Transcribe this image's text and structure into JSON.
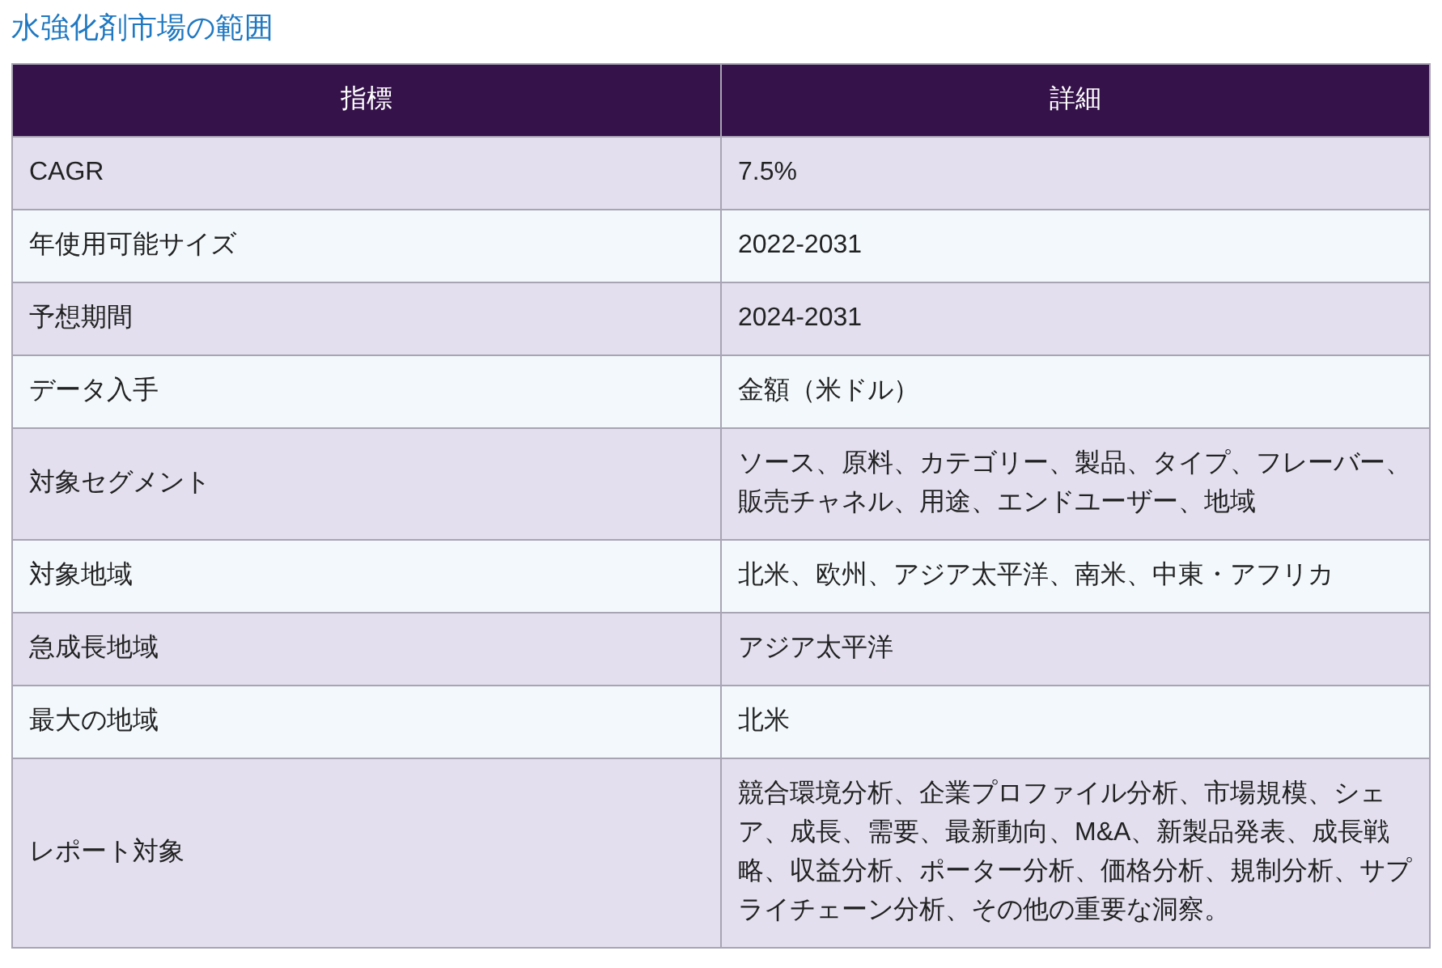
{
  "title": "水強化剤市場の範囲",
  "table": {
    "columns": [
      "指標",
      "詳細"
    ],
    "rows": [
      [
        "CAGR",
        "7.5%"
      ],
      [
        "年使用可能サイズ",
        "2022-2031"
      ],
      [
        "予想期間",
        "2024-2031"
      ],
      [
        "データ入手",
        "金額（米ドル）"
      ],
      [
        "対象セグメント",
        "ソース、原料、カテゴリー、製品、タイプ、フレーバー、販売チャネル、用途、エンドユーザー、地域"
      ],
      [
        "対象地域",
        "北米、欧州、アジア太平洋、南米、中東・アフリカ"
      ],
      [
        "急成長地域",
        "アジア太平洋"
      ],
      [
        "最大の地域",
        "北米"
      ],
      [
        "レポート対象",
        "競合環境分析、企業プロファイル分析、市場規模、シェア、成長、需要、最新動向、M&A、新製品発表、成長戦略、収益分析、ポーター分析、価格分析、規制分析、サプライチェーン分析、その他の重要な洞察。"
      ]
    ]
  }
}
